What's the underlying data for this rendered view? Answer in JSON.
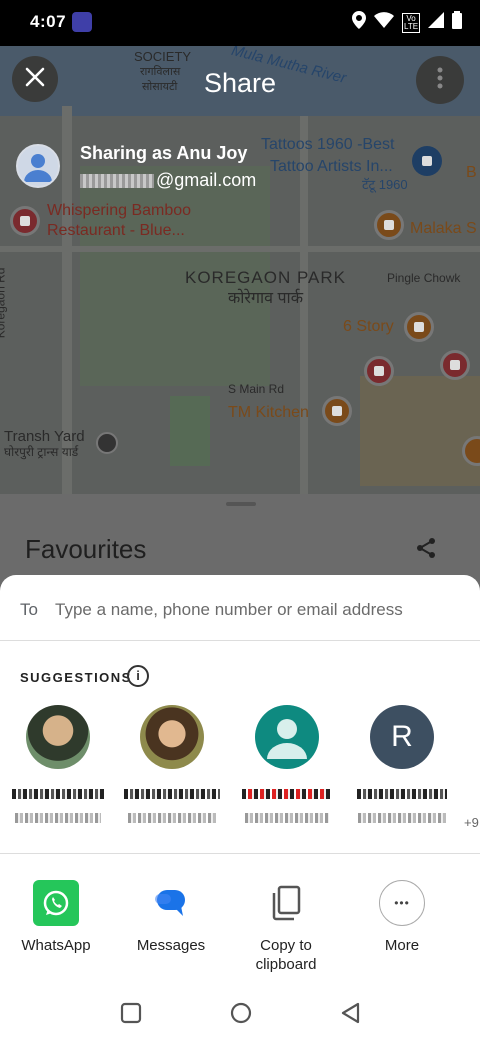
{
  "status_bar": {
    "time": "4:07",
    "lte_label": "Vo LTE"
  },
  "map": {
    "labels": {
      "society": "SOCIETY",
      "society_hi1": "रागविलास",
      "society_hi2": "सोसायटी",
      "river": "Mula Mutha River",
      "tattoos1": "Tattoos 1960 -Best",
      "tattoos2": "Tattoo Artists In...",
      "tattoos_hi": "टॅटू 1960",
      "whispering1": "Whispering Bamboo",
      "whispering2": "Restaurant - Blue...",
      "malaka": "Malaka S",
      "koregaon_park": "KOREGAON PARK",
      "koregaon_park_hi": "कोरेगाव पार्क",
      "pingle": "Pingle Chowk",
      "koregaon_rd": "Koregaon Rd",
      "six_story": "6 Story",
      "s_main_rd": "S Main Rd",
      "tm_kitchen": "TM Kitchen",
      "transh1": "Transh Yard",
      "transh2": "घोरपुरी ट्रान्स यार्ड"
    }
  },
  "share_header": {
    "title": "Share",
    "account_line": "Sharing as Anu Joy",
    "email_suffix": "@gmail.com"
  },
  "back_sheet": {
    "title": "Favourites"
  },
  "sheet": {
    "to_label": "To",
    "to_placeholder": "Type a name, phone number or email address",
    "suggestions_title": "SUGGESTIONS",
    "info_glyph": "i",
    "contacts": [
      {
        "initial": ""
      },
      {
        "initial": ""
      },
      {
        "initial": ""
      },
      {
        "initial": "R"
      }
    ],
    "more_count": "+9",
    "apps": [
      {
        "label": "WhatsApp"
      },
      {
        "label": "Messages"
      },
      {
        "label": "Copy to clipboard"
      },
      {
        "label": "More"
      }
    ],
    "more_glyph": "•••"
  }
}
